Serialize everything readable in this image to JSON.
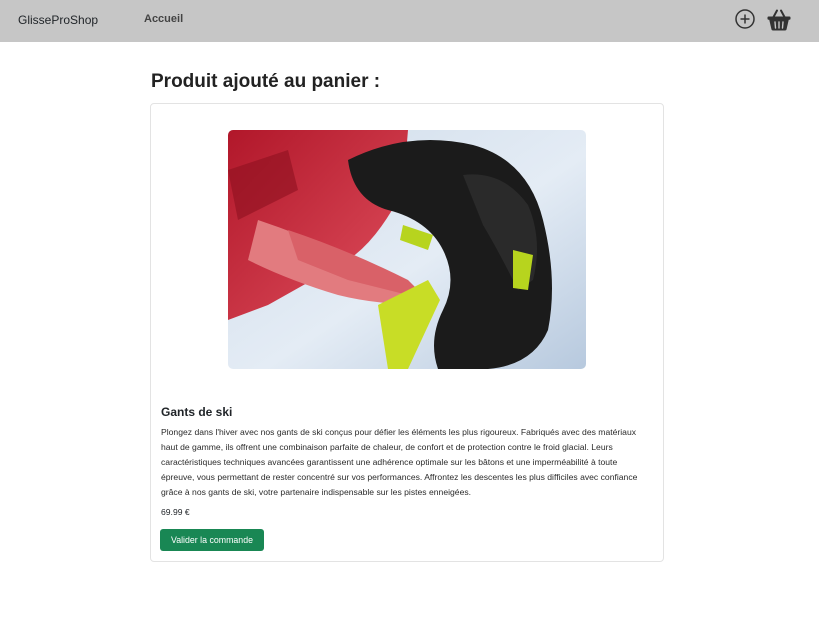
{
  "navbar": {
    "brand": "GlisseProShop",
    "links": [
      {
        "label": "Accueil"
      }
    ],
    "icons": [
      "add-circle-icon",
      "shopping-basket-icon"
    ]
  },
  "page": {
    "title": "Produit ajouté au panier :"
  },
  "product": {
    "image_description": "ski-glove-photo",
    "name": "Gants de ski",
    "description": "Plongez dans l'hiver avec nos gants de ski conçus pour défier les éléments les plus rigoureux. Fabriqués avec des matériaux haut de gamme, ils offrent une combinaison parfaite de chaleur, de confort et de protection contre le froid glacial. Leurs caractéristiques techniques avancées garantissent une adhérence optimale sur les bâtons et une imperméabilité à toute épreuve, vous permettant de rester concentré sur vos performances. Affrontez les descentes les plus difficiles avec confiance grâce à nos gants de ski, votre partenaire indispensable sur les pistes enneigées.",
    "price": "69.99 €",
    "button_label": "Valider la commande"
  },
  "colors": {
    "navbar_bg": "#c6c6c6",
    "button_bg": "#198754",
    "button_text": "#ffffff"
  }
}
